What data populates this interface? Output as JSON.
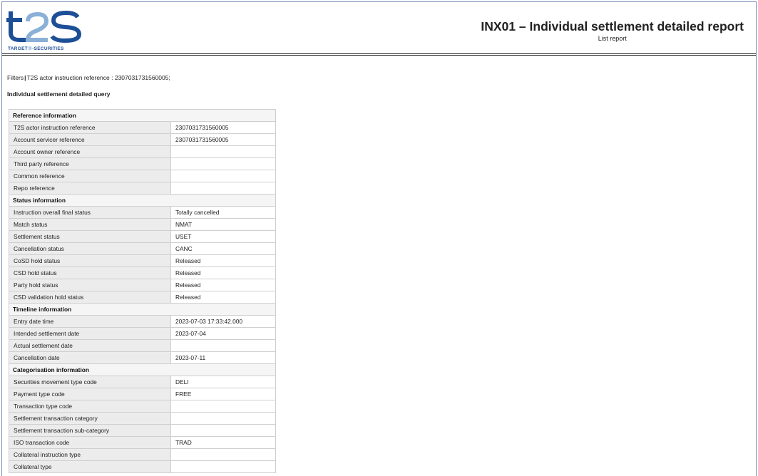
{
  "header": {
    "logo_text": "TARGET2-SECURITIES",
    "logo_letters": "t2s",
    "title": "INX01 – Individual settlement detailed report",
    "subtitle": "List report"
  },
  "filters": {
    "label": "Filters",
    "text": "T2S actor instruction reference : 2307031731560005;"
  },
  "section_title": "Individual settlement detailed query",
  "groups": [
    {
      "title": "Reference information",
      "rows": [
        {
          "label": "T2S actor instruction reference",
          "value": "2307031731560005"
        },
        {
          "label": "Account servicer reference",
          "value": "2307031731560005"
        },
        {
          "label": "Account owner reference",
          "value": ""
        },
        {
          "label": "Third party reference",
          "value": ""
        },
        {
          "label": "Common reference",
          "value": ""
        },
        {
          "label": "Repo reference",
          "value": ""
        }
      ]
    },
    {
      "title": "Status information",
      "rows": [
        {
          "label": "Instruction overall final status",
          "value": "Totally cancelled"
        },
        {
          "label": "Match status",
          "value": "NMAT"
        },
        {
          "label": "Settlement status",
          "value": "USET"
        },
        {
          "label": "Cancellation status",
          "value": "CANC"
        },
        {
          "label": "CoSD hold status",
          "value": "Released"
        },
        {
          "label": "CSD hold status",
          "value": "Released"
        },
        {
          "label": "Party hold status",
          "value": "Released"
        },
        {
          "label": "CSD validation hold status",
          "value": "Released"
        }
      ]
    },
    {
      "title": "Timeline information",
      "rows": [
        {
          "label": "Entry date time",
          "value": "2023-07-03 17:33:42.000"
        },
        {
          "label": "Intended settlement date",
          "value": "2023-07-04"
        },
        {
          "label": "Actual settlement date",
          "value": ""
        },
        {
          "label": "Cancellation date",
          "value": "2023-07-11"
        }
      ]
    },
    {
      "title": "Categorisation information",
      "rows": [
        {
          "label": "Securities movement type code",
          "value": "DELI"
        },
        {
          "label": "Payment type code",
          "value": "FREE"
        },
        {
          "label": "Transaction type code",
          "value": ""
        },
        {
          "label": "Settlement transaction category",
          "value": ""
        },
        {
          "label": "Settlement transaction sub-category",
          "value": ""
        },
        {
          "label": "ISO transaction code",
          "value": "TRAD"
        },
        {
          "label": "Collateral instruction type",
          "value": ""
        },
        {
          "label": "Collateral type",
          "value": ""
        }
      ]
    }
  ]
}
